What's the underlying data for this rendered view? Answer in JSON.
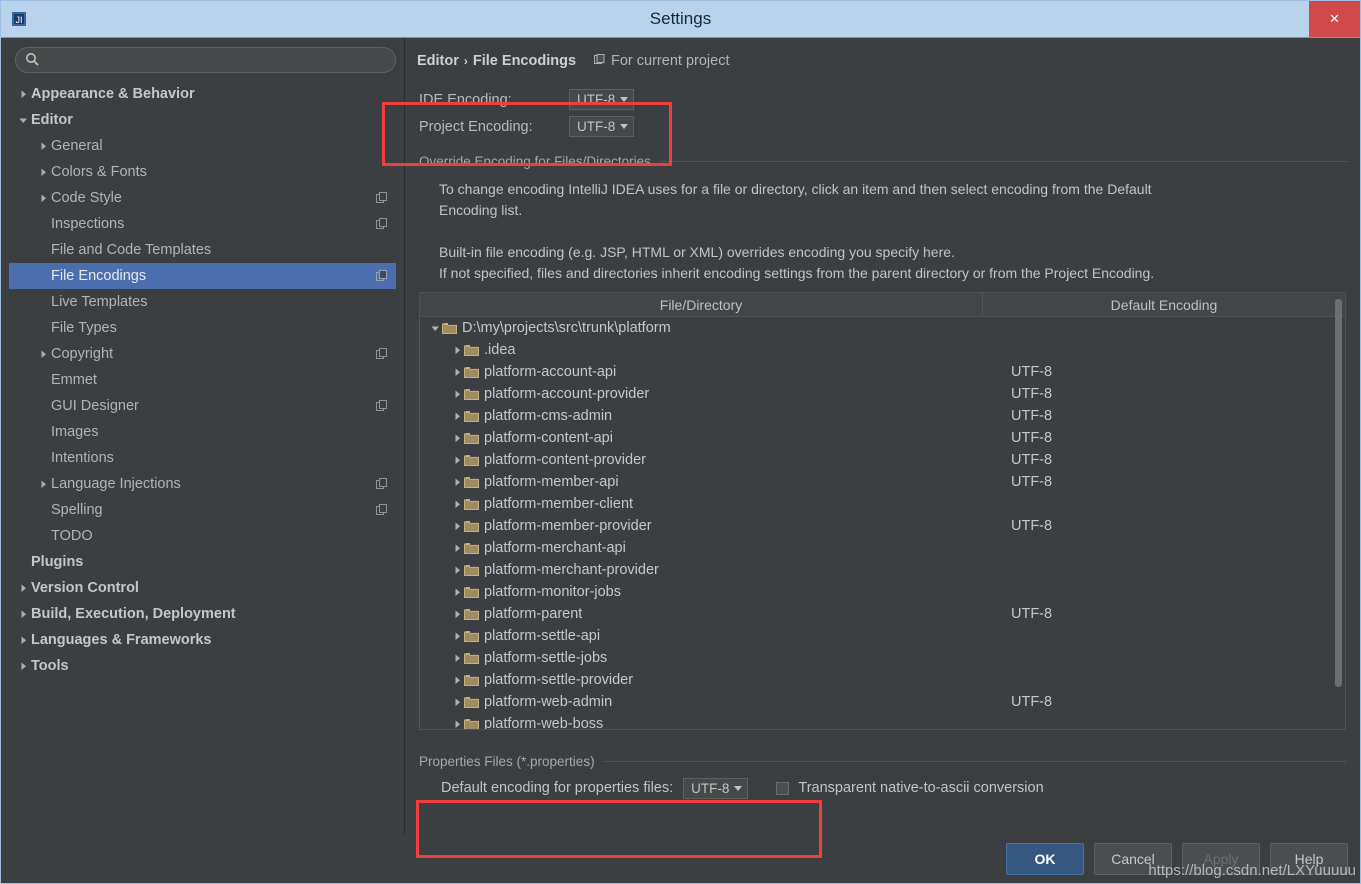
{
  "window": {
    "title": "Settings",
    "app_icon": "intellij-idea-icon",
    "close_label": "×"
  },
  "sidebar": {
    "search": {
      "value": "",
      "placeholder": "",
      "icon": "search-icon"
    },
    "items": [
      {
        "label": "Appearance & Behavior",
        "indent": 0,
        "bold": true,
        "twisty": "collapsed",
        "selected": false,
        "project_icon": false
      },
      {
        "label": "Editor",
        "indent": 0,
        "bold": true,
        "twisty": "expanded",
        "selected": false,
        "project_icon": false
      },
      {
        "label": "General",
        "indent": 1,
        "bold": false,
        "twisty": "collapsed",
        "selected": false,
        "project_icon": false
      },
      {
        "label": "Colors & Fonts",
        "indent": 1,
        "bold": false,
        "twisty": "collapsed",
        "selected": false,
        "project_icon": false
      },
      {
        "label": "Code Style",
        "indent": 1,
        "bold": false,
        "twisty": "collapsed",
        "selected": false,
        "project_icon": true
      },
      {
        "label": "Inspections",
        "indent": 1,
        "bold": false,
        "twisty": "none",
        "selected": false,
        "project_icon": true
      },
      {
        "label": "File and Code Templates",
        "indent": 1,
        "bold": false,
        "twisty": "none",
        "selected": false,
        "project_icon": false
      },
      {
        "label": "File Encodings",
        "indent": 1,
        "bold": false,
        "twisty": "none",
        "selected": true,
        "project_icon": true
      },
      {
        "label": "Live Templates",
        "indent": 1,
        "bold": false,
        "twisty": "none",
        "selected": false,
        "project_icon": false
      },
      {
        "label": "File Types",
        "indent": 1,
        "bold": false,
        "twisty": "none",
        "selected": false,
        "project_icon": false
      },
      {
        "label": "Copyright",
        "indent": 1,
        "bold": false,
        "twisty": "collapsed",
        "selected": false,
        "project_icon": true
      },
      {
        "label": "Emmet",
        "indent": 1,
        "bold": false,
        "twisty": "none",
        "selected": false,
        "project_icon": false
      },
      {
        "label": "GUI Designer",
        "indent": 1,
        "bold": false,
        "twisty": "none",
        "selected": false,
        "project_icon": true
      },
      {
        "label": "Images",
        "indent": 1,
        "bold": false,
        "twisty": "none",
        "selected": false,
        "project_icon": false
      },
      {
        "label": "Intentions",
        "indent": 1,
        "bold": false,
        "twisty": "none",
        "selected": false,
        "project_icon": false
      },
      {
        "label": "Language Injections",
        "indent": 1,
        "bold": false,
        "twisty": "collapsed",
        "selected": false,
        "project_icon": true
      },
      {
        "label": "Spelling",
        "indent": 1,
        "bold": false,
        "twisty": "none",
        "selected": false,
        "project_icon": true
      },
      {
        "label": "TODO",
        "indent": 1,
        "bold": false,
        "twisty": "none",
        "selected": false,
        "project_icon": false
      },
      {
        "label": "Plugins",
        "indent": 0,
        "bold": true,
        "twisty": "none",
        "selected": false,
        "project_icon": false
      },
      {
        "label": "Version Control",
        "indent": 0,
        "bold": true,
        "twisty": "collapsed",
        "selected": false,
        "project_icon": false
      },
      {
        "label": "Build, Execution, Deployment",
        "indent": 0,
        "bold": true,
        "twisty": "collapsed",
        "selected": false,
        "project_icon": false
      },
      {
        "label": "Languages & Frameworks",
        "indent": 0,
        "bold": true,
        "twisty": "collapsed",
        "selected": false,
        "project_icon": false
      },
      {
        "label": "Tools",
        "indent": 0,
        "bold": true,
        "twisty": "collapsed",
        "selected": false,
        "project_icon": false
      }
    ]
  },
  "content": {
    "breadcrumb": {
      "parent": "Editor",
      "separator": "›",
      "current": "File Encodings"
    },
    "scope": {
      "label": "For current project",
      "icon": "project-scope-icon"
    },
    "ide_encoding": {
      "label": "IDE Encoding:",
      "value": "UTF-8"
    },
    "project_encoding": {
      "label": "Project Encoding:",
      "value": "UTF-8"
    },
    "override_section_title": "Override Encoding for Files/Directories",
    "description": {
      "line1": "To change encoding IntelliJ IDEA uses for a file or directory, click an item and then select encoding from the Default",
      "line2": "Encoding list.",
      "line3": "Built-in file encoding (e.g. JSP, HTML or XML) overrides encoding you specify here.",
      "line4": "If not specified, files and directories inherit encoding settings from the parent directory or from the Project Encoding."
    },
    "table": {
      "columns": [
        "File/Directory",
        "Default Encoding"
      ],
      "rows": [
        {
          "name": "D:\\my\\projects\\src\\trunk\\platform",
          "encoding": "",
          "indent": 0,
          "twisty": "expanded"
        },
        {
          "name": ".idea",
          "encoding": "",
          "indent": 1,
          "twisty": "collapsed"
        },
        {
          "name": "platform-account-api",
          "encoding": "UTF-8",
          "indent": 1,
          "twisty": "collapsed"
        },
        {
          "name": "platform-account-provider",
          "encoding": "UTF-8",
          "indent": 1,
          "twisty": "collapsed"
        },
        {
          "name": "platform-cms-admin",
          "encoding": "UTF-8",
          "indent": 1,
          "twisty": "collapsed"
        },
        {
          "name": "platform-content-api",
          "encoding": "UTF-8",
          "indent": 1,
          "twisty": "collapsed"
        },
        {
          "name": "platform-content-provider",
          "encoding": "UTF-8",
          "indent": 1,
          "twisty": "collapsed"
        },
        {
          "name": "platform-member-api",
          "encoding": "UTF-8",
          "indent": 1,
          "twisty": "collapsed"
        },
        {
          "name": "platform-member-client",
          "encoding": "",
          "indent": 1,
          "twisty": "collapsed"
        },
        {
          "name": "platform-member-provider",
          "encoding": "UTF-8",
          "indent": 1,
          "twisty": "collapsed"
        },
        {
          "name": "platform-merchant-api",
          "encoding": "",
          "indent": 1,
          "twisty": "collapsed"
        },
        {
          "name": "platform-merchant-provider",
          "encoding": "",
          "indent": 1,
          "twisty": "collapsed"
        },
        {
          "name": "platform-monitor-jobs",
          "encoding": "",
          "indent": 1,
          "twisty": "collapsed"
        },
        {
          "name": "platform-parent",
          "encoding": "UTF-8",
          "indent": 1,
          "twisty": "collapsed"
        },
        {
          "name": "platform-settle-api",
          "encoding": "",
          "indent": 1,
          "twisty": "collapsed"
        },
        {
          "name": "platform-settle-jobs",
          "encoding": "",
          "indent": 1,
          "twisty": "collapsed"
        },
        {
          "name": "platform-settle-provider",
          "encoding": "",
          "indent": 1,
          "twisty": "collapsed"
        },
        {
          "name": "platform-web-admin",
          "encoding": "UTF-8",
          "indent": 1,
          "twisty": "collapsed"
        },
        {
          "name": "platform-web-boss",
          "encoding": "",
          "indent": 1,
          "twisty": "collapsed"
        }
      ]
    },
    "properties": {
      "section_title": "Properties Files (*.properties)",
      "default_encoding_label": "Default encoding for properties files:",
      "default_encoding_value": "UTF-8",
      "transparent_label": "Transparent native-to-ascii conversion",
      "transparent_checked": false
    }
  },
  "footer": {
    "ok": "OK",
    "cancel": "Cancel",
    "apply": "Apply",
    "help": "Help"
  },
  "watermark": "https://blog.csdn.net/LXYuuuuu",
  "colors": {
    "accent": "#4b6eaf",
    "annotation": "#f03d3d",
    "titlebar": "#b9d3ec",
    "close": "#d04a4a",
    "background": "#3c3f41"
  }
}
